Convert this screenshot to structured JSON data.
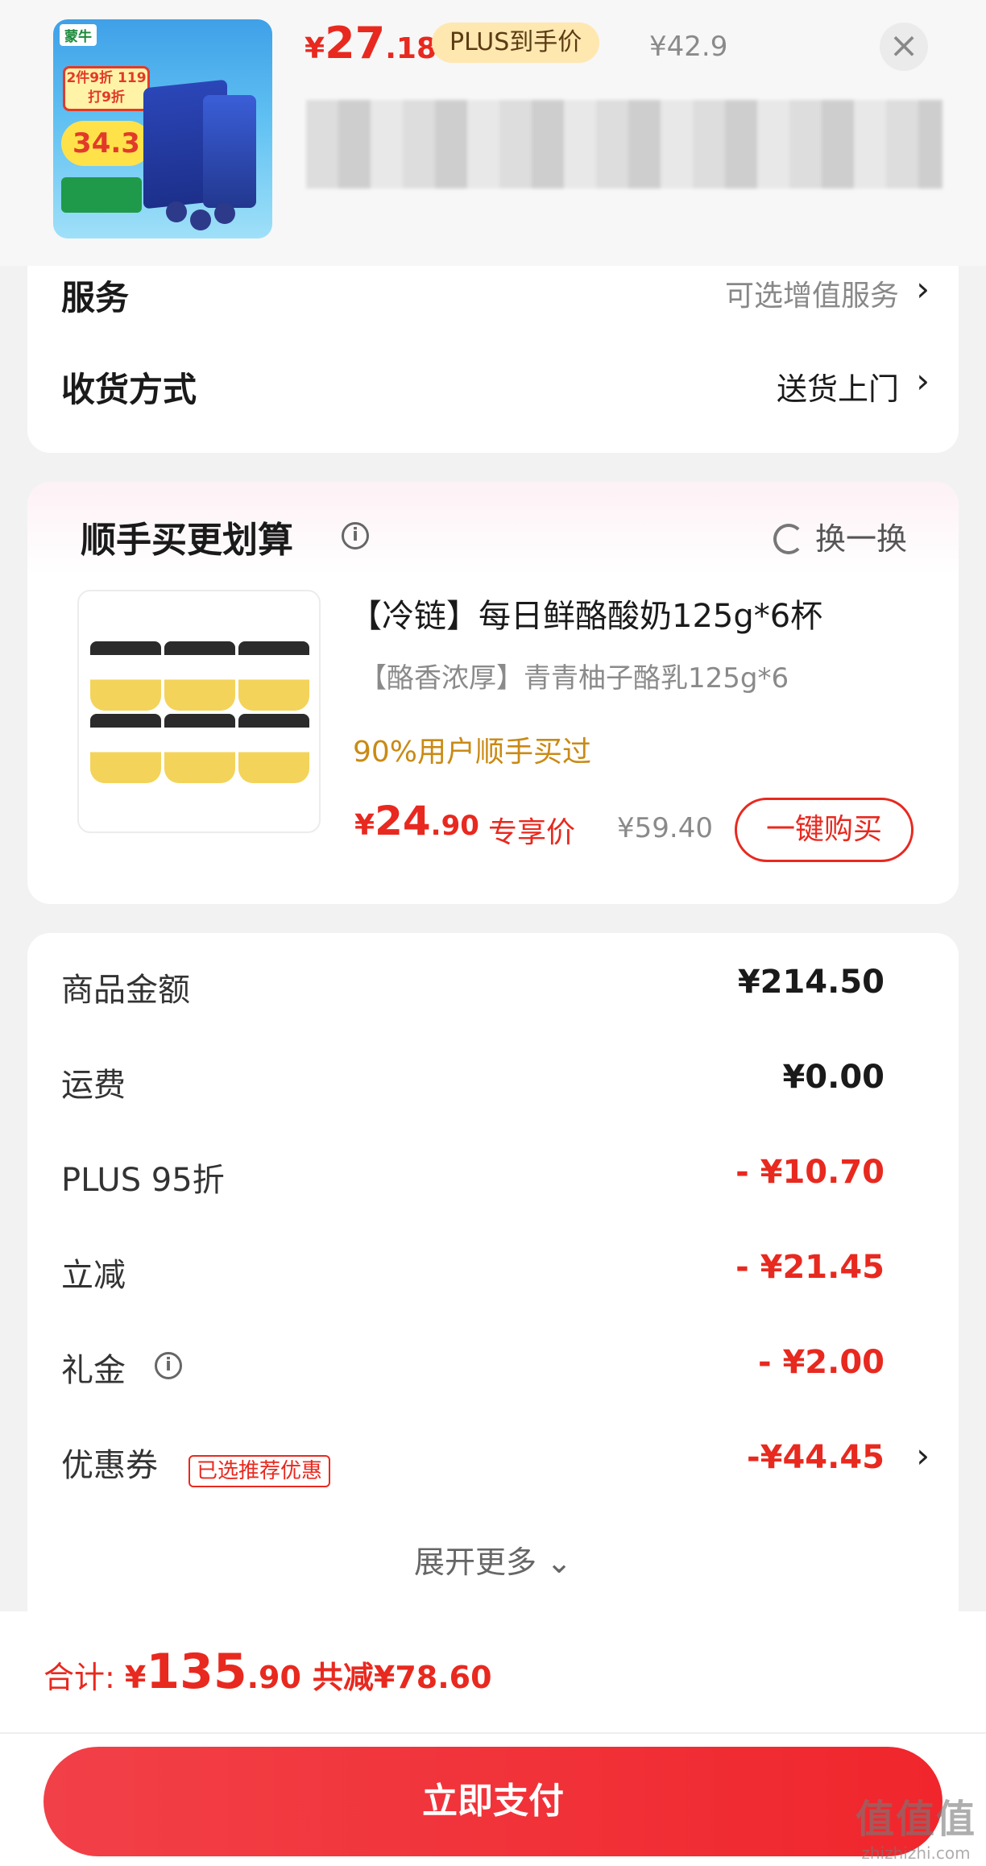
{
  "header": {
    "price_currency": "¥",
    "price_int": "27",
    "price_dec": ".18",
    "plus_badge": "PLUS到手价",
    "original_price": "¥42.9",
    "close_icon": "close-icon",
    "thumb": {
      "logo": "蒙牛",
      "tag": "2件9折 119打9折",
      "price_tag": "34.3"
    }
  },
  "service": {
    "service_label": "服务",
    "service_value": "可选增值服务",
    "delivery_label": "收货方式",
    "delivery_value": "送货上门"
  },
  "recommend": {
    "title": "顺手买更划算",
    "swap_label": "换一换",
    "product": {
      "name": "【冷链】每日鲜酪酸奶125g*6杯",
      "subtitle": "【酪香浓厚】青青柚子酪乳125g*6",
      "note": "90%用户顺手买过",
      "price_currency": "¥",
      "price_int": "24",
      "price_dec": ".90",
      "price_tag": "专享价",
      "original_price": "¥59.40",
      "buy_label": "一键购买"
    }
  },
  "summary": {
    "rows": [
      {
        "label": "商品金额",
        "value": "¥214.50"
      },
      {
        "label": "运费",
        "value": "¥0.00"
      },
      {
        "label": "PLUS 95折",
        "value": "- ¥10.70"
      },
      {
        "label": "立减",
        "value": "- ¥21.45"
      },
      {
        "label": "礼金",
        "value": "- ¥2.00"
      },
      {
        "label": "优惠券",
        "value": "-¥44.45"
      }
    ],
    "coupon_badge": "已选推荐优惠",
    "expand_label": "展开更多"
  },
  "footer": {
    "total_label": "合计: ",
    "total_currency": "¥",
    "total_int": "135",
    "total_dec": ".90",
    "total_save": "共减¥78.60",
    "pay_label": "立即支付",
    "watermark_big": "值值值",
    "watermark_small": "zhizhizhi.com"
  },
  "colors": {
    "accent": "#e8291f",
    "plus_badge_bg": "#ffe7b0",
    "note": "#c98a14"
  }
}
